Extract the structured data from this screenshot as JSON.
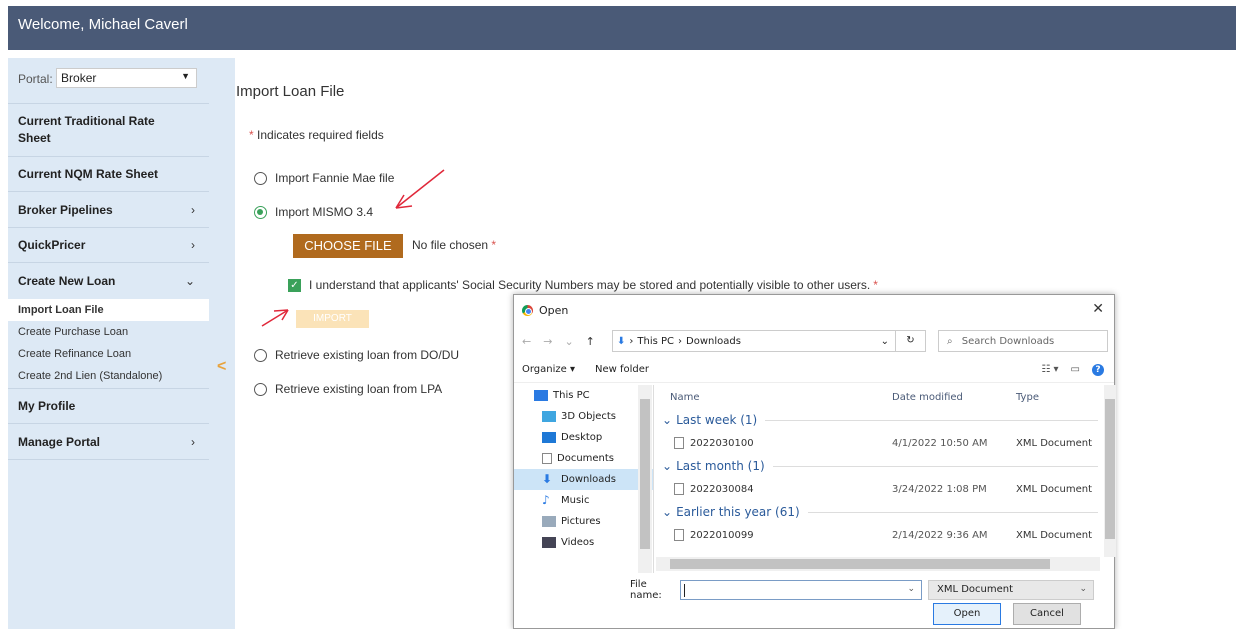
{
  "header": {
    "welcome": "Welcome, Michael Caverl"
  },
  "sidebar": {
    "portal_label": "Portal:",
    "portal_value": "Broker",
    "items": [
      {
        "label": "Current Traditional Rate Sheet",
        "arrow": ""
      },
      {
        "label": "Current NQM Rate Sheet",
        "arrow": ""
      },
      {
        "label": "Broker Pipelines",
        "arrow": "›"
      },
      {
        "label": "QuickPricer",
        "arrow": "›"
      },
      {
        "label": "Create New Loan",
        "arrow": "⌄"
      },
      {
        "label": "My Profile",
        "arrow": ""
      },
      {
        "label": "Manage Portal",
        "arrow": "›"
      }
    ],
    "sub_items": [
      {
        "label": "Import Loan File",
        "active": true
      },
      {
        "label": "Create Purchase Loan",
        "active": false
      },
      {
        "label": "Create Refinance Loan",
        "active": false
      },
      {
        "label": "Create 2nd Lien (Standalone)",
        "active": false
      }
    ],
    "collapse_glyph": "<"
  },
  "main": {
    "title": "Import Loan File",
    "required_star": "*",
    "required_text": " Indicates required fields",
    "options": [
      {
        "label": "Import Fannie Mae file",
        "checked": false
      },
      {
        "label": "Import MISMO 3.4",
        "checked": true
      },
      {
        "label": "Retrieve existing loan from DO/DU",
        "checked": false
      },
      {
        "label": "Retrieve existing loan from LPA",
        "checked": false
      }
    ],
    "choose_file_label": "CHOOSE FILE",
    "no_file_text": "No file chosen",
    "ssn_ack_text": "I understand that applicants' Social Security Numbers may be stored and potentially visible to other users.",
    "checkbox_glyph": "✓",
    "import_label": "IMPORT"
  },
  "dialog": {
    "title": "Open",
    "close_glyph": "✕",
    "nav_glyphs": [
      "←",
      "→",
      "⌄",
      "↑"
    ],
    "path_segments": [
      "This PC",
      "Downloads"
    ],
    "path_separator": "›",
    "refresh_glyph": "↻",
    "search_placeholder": "Search Downloads",
    "search_glyph": "⌕",
    "organize_label": "Organize ▾",
    "new_folder_label": "New folder",
    "view_glyphs": [
      "☷ ▾",
      "▭"
    ],
    "help_glyph": "?",
    "tree": [
      {
        "label": "This PC",
        "icon": "pc-icon"
      },
      {
        "label": "3D Objects",
        "icon": "cube-icon"
      },
      {
        "label": "Desktop",
        "icon": "desktop-icon"
      },
      {
        "label": "Documents",
        "icon": "documents-icon"
      },
      {
        "label": "Downloads",
        "icon": "downloads-icon",
        "selected": true
      },
      {
        "label": "Music",
        "icon": "music-icon"
      },
      {
        "label": "Pictures",
        "icon": "pictures-icon"
      },
      {
        "label": "Videos",
        "icon": "videos-icon"
      }
    ],
    "columns": [
      "Name",
      "Date modified",
      "Type"
    ],
    "groups": [
      {
        "label": "Last week (1)",
        "files": [
          {
            "name": "2022030100",
            "date": "4/1/2022 10:50 AM",
            "type": "XML Document"
          }
        ]
      },
      {
        "label": "Last month (1)",
        "files": [
          {
            "name": "2022030084",
            "date": "3/24/2022 1:08 PM",
            "type": "XML Document"
          }
        ]
      },
      {
        "label": "Earlier this year (61)",
        "files": [
          {
            "name": "2022010099",
            "date": "2/14/2022 9:36 AM",
            "type": "XML Document"
          }
        ]
      }
    ],
    "file_name_label": "File name:",
    "file_name_value": "",
    "file_type_value": "XML Document",
    "open_label": "Open",
    "cancel_label": "Cancel"
  },
  "colors": {
    "header_bg": "#4a5a77",
    "sidebar_bg": "#dde9f5",
    "choose_btn": "#b06a1e",
    "check_green": "#3aa15a",
    "annotation_red": "#e0283a"
  }
}
